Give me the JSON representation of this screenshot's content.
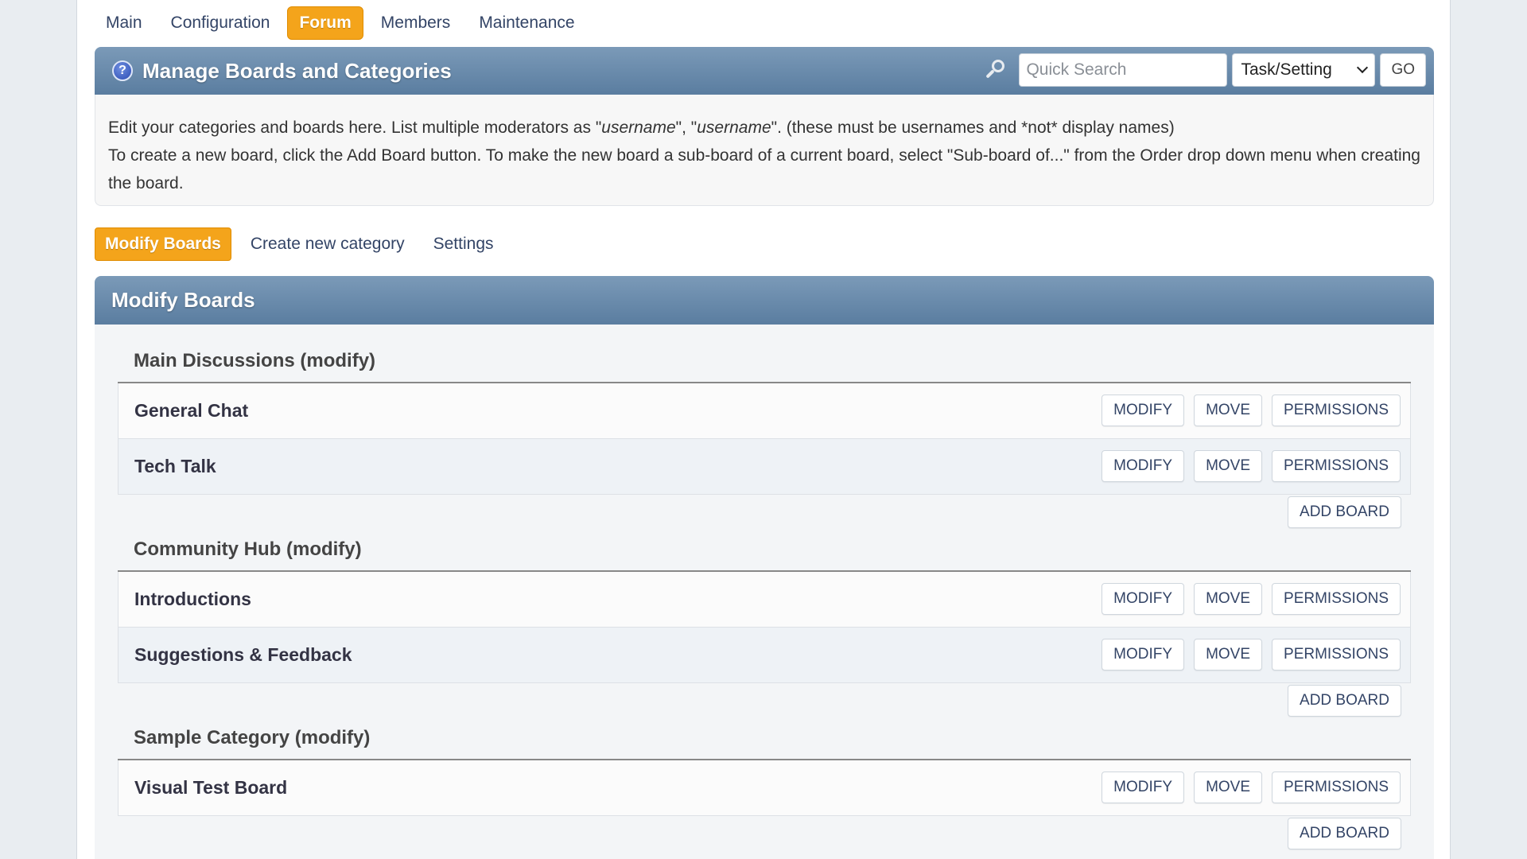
{
  "top_menu": [
    "Main",
    "Configuration",
    "Forum",
    "Members",
    "Maintenance"
  ],
  "header": {
    "title": "Manage Boards and Categories",
    "search_placeholder": "Quick Search",
    "search_type": "Task/Setting",
    "go_label": "GO"
  },
  "info": {
    "line1_pre": "Edit your categories and boards here. List multiple moderators as \"",
    "line1_u1": "username",
    "line1_mid": "\", \"",
    "line1_u2": "username",
    "line1_post": "\". (these must be usernames and *not* display names)",
    "line2": "To create a new board, click the Add Board button. To make the new board a sub-board of a current board, select \"Sub-board of...\" from the Order drop down menu when creating the board."
  },
  "tabs": [
    "Modify Boards",
    "Create new category",
    "Settings"
  ],
  "section_title": "Modify Boards",
  "buttons": {
    "modify": "MODIFY",
    "move": "MOVE",
    "permissions": "PERMISSIONS",
    "add_board": "ADD BOARD"
  },
  "categories": [
    {
      "name": "Main Discussions (modify)",
      "boards": [
        "General Chat",
        "Tech Talk"
      ]
    },
    {
      "name": "Community Hub (modify)",
      "boards": [
        "Introductions",
        "Suggestions & Feedback"
      ]
    },
    {
      "name": "Sample Category (modify)",
      "boards": [
        "Visual Test Board"
      ]
    }
  ],
  "colors": {
    "accent": "#f4a41b",
    "header_bar": "#6b8bad"
  }
}
